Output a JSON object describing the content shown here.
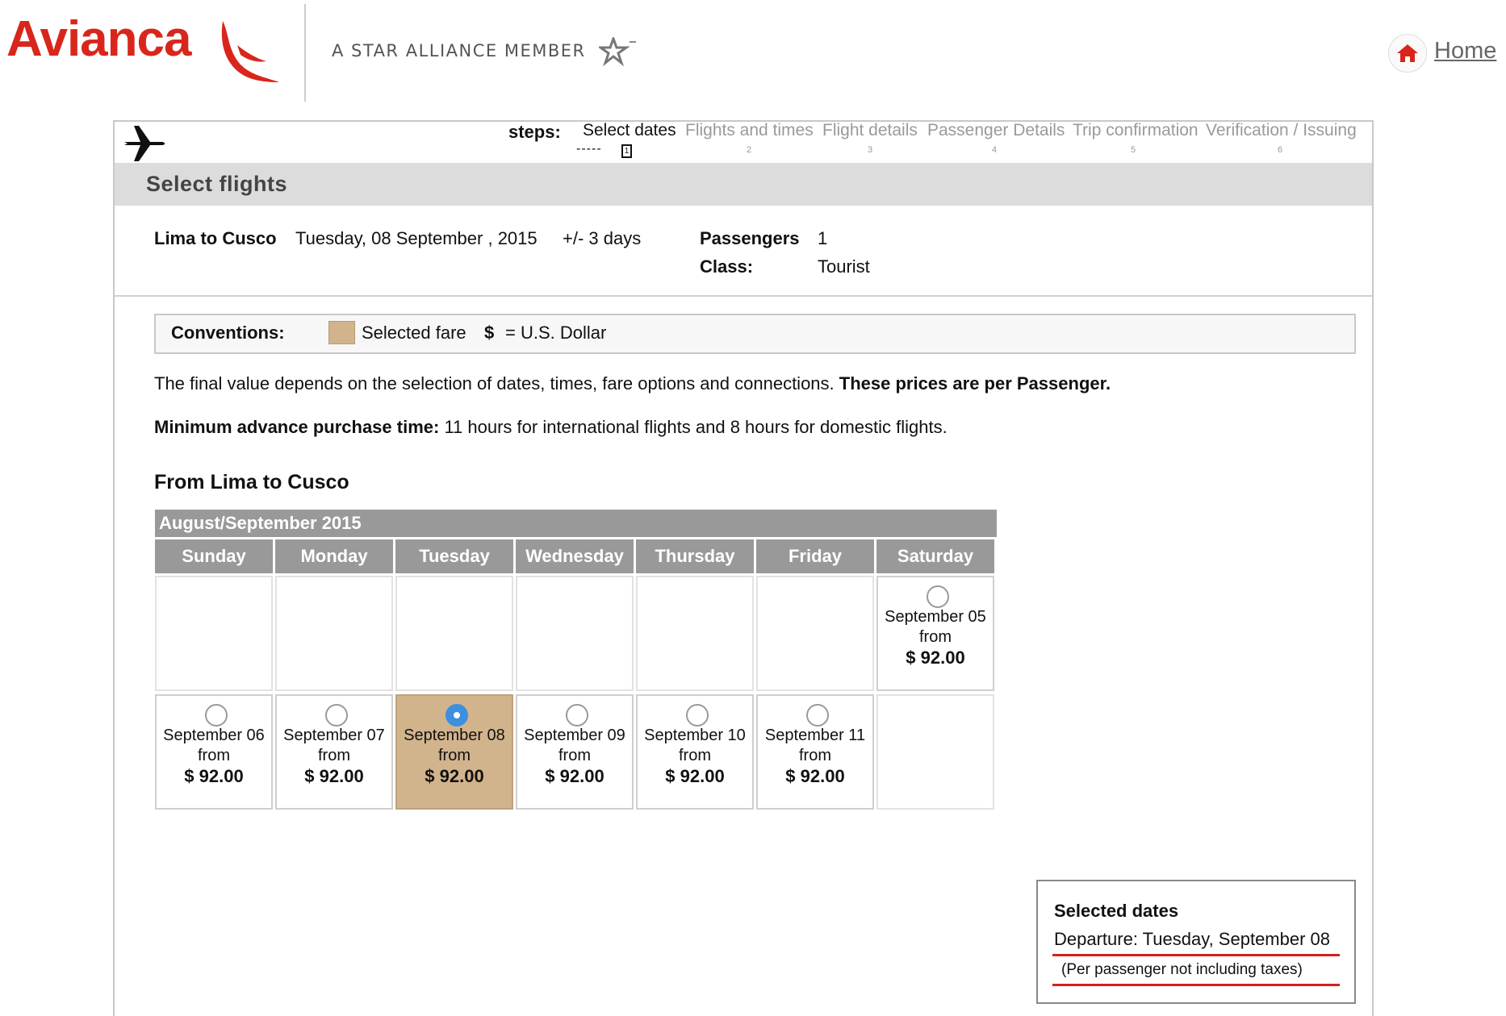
{
  "header": {
    "brand": "Avianca",
    "alliance": "A STAR ALLIANCE MEMBER",
    "home_label": "Home",
    "brand_color": "#d9261c"
  },
  "steps": {
    "label": "steps:",
    "items": [
      {
        "label": "Select dates",
        "num": "1",
        "active": true
      },
      {
        "label": "Flights and times",
        "num": "2",
        "active": false
      },
      {
        "label": "Flight details",
        "num": "3",
        "active": false
      },
      {
        "label": "Passenger Details",
        "num": "4",
        "active": false
      },
      {
        "label": "Trip confirmation",
        "num": "5",
        "active": false
      },
      {
        "label": "Verification / Issuing",
        "num": "6",
        "active": false
      }
    ]
  },
  "page_title": "Select flights",
  "trip": {
    "route": "Lima to Cusco",
    "date": "Tuesday, 08 September , 2015",
    "range": "+/- 3 days",
    "passengers_label": "Passengers",
    "passengers_value": "1",
    "class_label": "Class:",
    "class_value": "Tourist"
  },
  "conventions": {
    "label": "Conventions:",
    "selected_fare": "Selected fare",
    "dollar_symbol": "$",
    "dollar_text": "= U.S. Dollar",
    "selected_color": "#d2b48c"
  },
  "notice": {
    "text": "The final value depends on the selection of dates, times, fare options and connections. ",
    "bold": "These prices are per Passenger."
  },
  "min_advance": {
    "label": "Minimum advance purchase time:",
    "text": " 11 hours for international flights and 8 hours for domestic flights."
  },
  "calendar": {
    "section_title": "From Lima to Cusco",
    "month_label": "August/September 2015",
    "days": [
      "Sunday",
      "Monday",
      "Tuesday",
      "Wednesday",
      "Thursday",
      "Friday",
      "Saturday"
    ],
    "from_label": "from",
    "cells": [
      {
        "date": "September 05",
        "price": "$ 92.00",
        "selected": false
      },
      {
        "date": "September 06",
        "price": "$ 92.00",
        "selected": false
      },
      {
        "date": "September 07",
        "price": "$ 92.00",
        "selected": false
      },
      {
        "date": "September 08",
        "price": "$ 92.00",
        "selected": true
      },
      {
        "date": "September 09",
        "price": "$ 92.00",
        "selected": false
      },
      {
        "date": "September 10",
        "price": "$ 92.00",
        "selected": false
      },
      {
        "date": "September 11",
        "price": "$ 92.00",
        "selected": false
      }
    ]
  },
  "selected_dates": {
    "title": "Selected dates",
    "departure": "Departure: Tuesday, September 08",
    "note": "(Per passenger not including taxes)"
  }
}
